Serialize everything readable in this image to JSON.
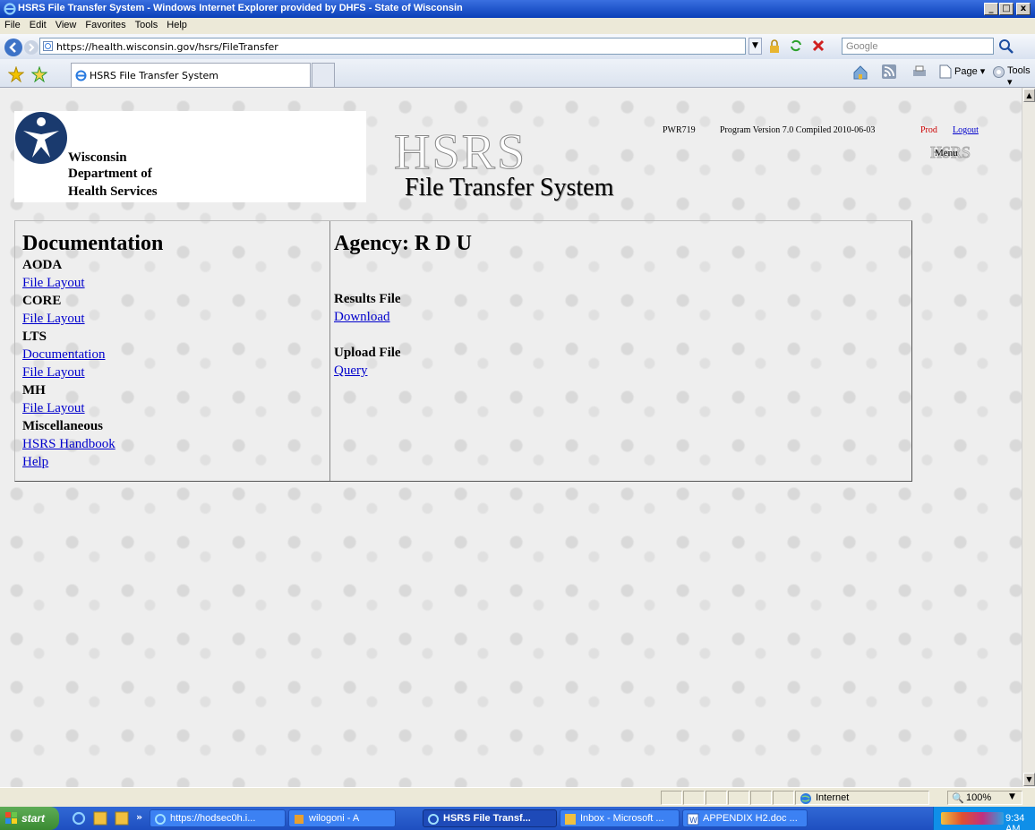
{
  "window": {
    "title": "HSRS File Transfer System - Windows Internet Explorer provided by DHFS - State of Wisconsin",
    "controls": [
      "_",
      "□",
      "x"
    ]
  },
  "menubar": [
    "File",
    "Edit",
    "View",
    "Favorites",
    "Tools",
    "Help"
  ],
  "address": {
    "url": "https://health.wisconsin.gov/hsrs/FileTransfer",
    "search_placeholder": "Google"
  },
  "tabs": [
    {
      "label": "HSRS File Transfer System"
    }
  ],
  "toolbar_right": {
    "page": "Page ▾",
    "tools": "Tools ▾"
  },
  "page": {
    "logo": {
      "line1": "Wisconsin",
      "line2": "Department of",
      "line3": "Health Services"
    },
    "banner_big": "HSRS",
    "banner_sub": "File Transfer System",
    "version": {
      "code": "PWR719",
      "text": "Program Version 7.0 Compiled 2010-06-03",
      "env": "Prod",
      "logout": "Logout"
    },
    "menu_badge": "HSRS",
    "menu_label": "Menu",
    "documentation": {
      "heading": "Documentation",
      "sections": [
        {
          "label": "AODA",
          "links": [
            "File Layout"
          ]
        },
        {
          "label": "CORE",
          "links": [
            "File Layout"
          ]
        },
        {
          "label": "LTS",
          "links": [
            "Documentation",
            "File Layout"
          ]
        },
        {
          "label": "MH",
          "links": [
            "File Layout"
          ]
        },
        {
          "label": "Miscellaneous",
          "links": [
            "HSRS Handbook",
            "Help"
          ]
        }
      ]
    },
    "agency": {
      "heading": "Agency: R D U",
      "results_label": "Results File",
      "results_link": "Download",
      "upload_label": "Upload File",
      "upload_link": "Query"
    }
  },
  "statusbar": {
    "zone": "Internet",
    "zoom": "100%"
  },
  "taskbar": {
    "start": "start",
    "items": [
      {
        "label": "https://hodsec0h.i...",
        "active": false
      },
      {
        "label": "wilogoni - A",
        "active": false
      },
      {
        "label": "HSRS File Transf...",
        "active": true
      },
      {
        "label": "Inbox - Microsoft ...",
        "active": false
      },
      {
        "label": "APPENDIX H2.doc ...",
        "active": false
      }
    ],
    "clock": "9:34 AM"
  },
  "colors": {
    "link": "#0000cc",
    "env": "#cc0000",
    "titlebar": "#0a3fb8"
  }
}
